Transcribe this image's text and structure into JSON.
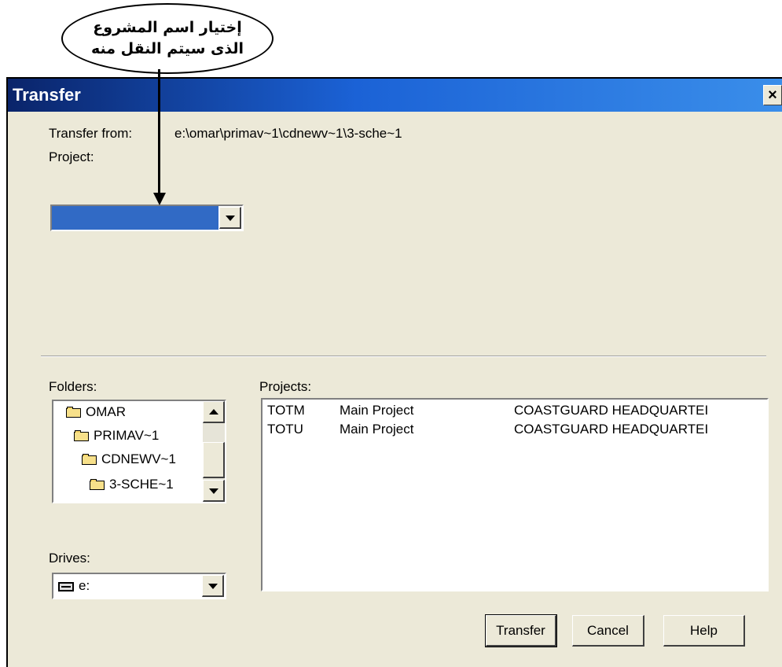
{
  "callout": {
    "line1": "إختيار اسم المشروع",
    "line2": "الذى سيتم النقل منه"
  },
  "dialog": {
    "title": "Transfer",
    "close_label": "×",
    "transfer_from_label": "Transfer from:",
    "transfer_from_value": "e:\\omar\\primav~1\\cdnewv~1\\3-sche~1",
    "project_label": "Project:",
    "project_value": "",
    "folders_label": "Folders:",
    "folders": [
      {
        "name": "OMAR",
        "icon": "open-folder-icon"
      },
      {
        "name": "PRIMAV~1",
        "icon": "open-folder-icon"
      },
      {
        "name": "CDNEWV~1",
        "icon": "open-folder-icon"
      },
      {
        "name": "3-SCHE~1",
        "icon": "open-folder-icon"
      }
    ],
    "drives_label": "Drives:",
    "drive_value": "e:",
    "projects_label": "Projects:",
    "projects": [
      {
        "code": "TOTM",
        "type": "Main Project",
        "name": "COASTGUARD HEADQUARTEI"
      },
      {
        "code": "TOTU",
        "type": "Main Project",
        "name": "COASTGUARD HEADQUARTEI"
      }
    ],
    "buttons": {
      "transfer": "Transfer",
      "cancel": "Cancel",
      "help": "Help"
    }
  },
  "colors": {
    "titlebar_start": "#0a246a",
    "titlebar_end": "#3a8eea",
    "dialog_bg": "#ece9d8",
    "selection": "#316ac5"
  }
}
